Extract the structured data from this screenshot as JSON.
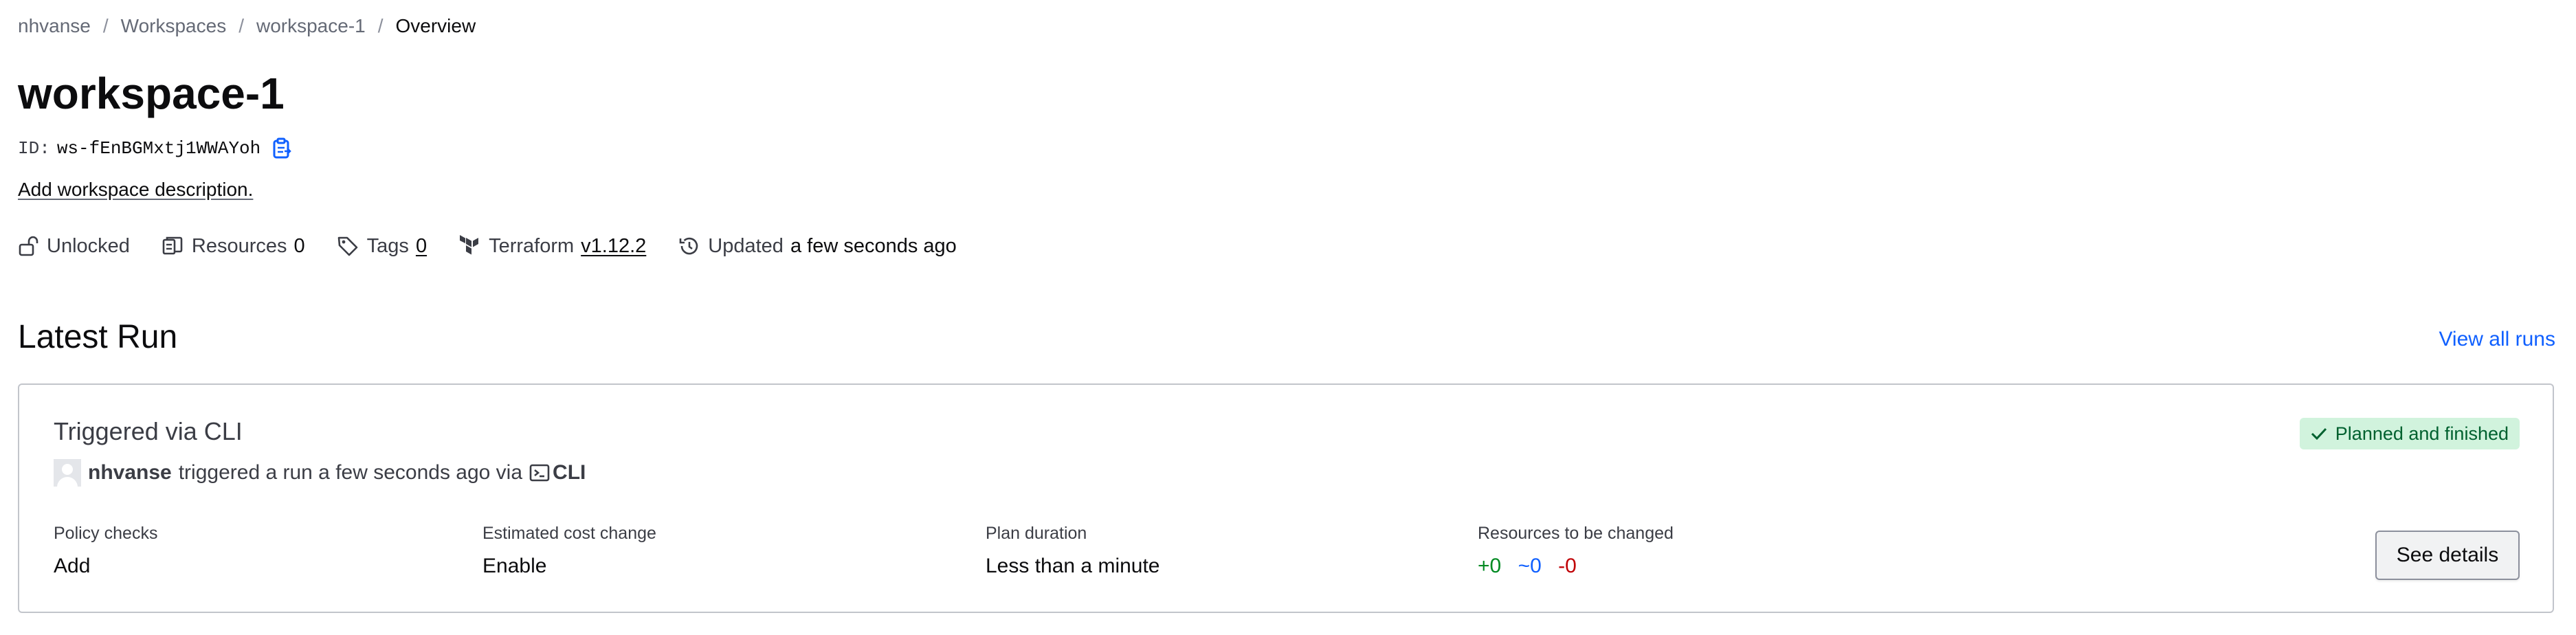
{
  "breadcrumb": {
    "items": [
      "nhvanse",
      "Workspaces",
      "workspace-1"
    ],
    "current": "Overview",
    "separator": "/"
  },
  "workspace": {
    "name": "workspace-1",
    "id_label": "ID:",
    "id": "ws-fEnBGMxtj1WWAYoh",
    "add_description": "Add workspace description."
  },
  "meta": {
    "lock": {
      "label": "Unlocked",
      "icon": "unlock-icon"
    },
    "resources": {
      "label": "Resources",
      "value": "0",
      "icon": "resources-icon"
    },
    "tags": {
      "label": "Tags",
      "value": "0",
      "icon": "tag-icon"
    },
    "terraform": {
      "label": "Terraform",
      "value": "v1.12.2",
      "icon": "terraform-logo-icon"
    },
    "updated": {
      "label": "Updated",
      "value": "a few seconds ago",
      "icon": "history-icon"
    }
  },
  "latest_run": {
    "heading": "Latest Run",
    "view_all": "View all runs",
    "title": "Triggered via CLI",
    "status": "Planned and finished",
    "user": "nhvanse",
    "byline_text": "triggered a run a few seconds ago via",
    "source": "CLI",
    "stats": {
      "policy_checks": {
        "label": "Policy checks",
        "value": "Add"
      },
      "cost_change": {
        "label": "Estimated cost change",
        "value": "Enable"
      },
      "plan_duration": {
        "label": "Plan duration",
        "value": "Less than a minute"
      },
      "resources_changed": {
        "label": "Resources to be changed",
        "add": "+0",
        "change": "~0",
        "destroy": "-0"
      }
    },
    "details_button": "See details"
  },
  "colors": {
    "link": "#1060ff",
    "status_bg": "#d1f3dd",
    "status_text": "#00612f",
    "add": "#008a22",
    "change": "#1060ff",
    "destroy": "#c00005"
  }
}
